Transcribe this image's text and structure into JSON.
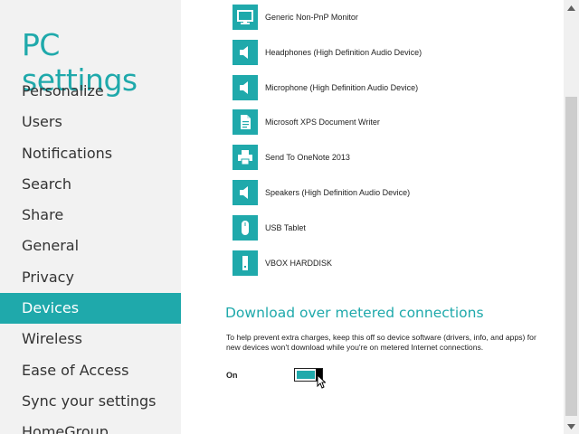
{
  "sidebar": {
    "title": "PC settings",
    "items": [
      {
        "label": "Personalize",
        "name": "personalize"
      },
      {
        "label": "Users",
        "name": "users"
      },
      {
        "label": "Notifications",
        "name": "notifications"
      },
      {
        "label": "Search",
        "name": "search"
      },
      {
        "label": "Share",
        "name": "share"
      },
      {
        "label": "General",
        "name": "general"
      },
      {
        "label": "Privacy",
        "name": "privacy"
      },
      {
        "label": "Devices",
        "name": "devices",
        "active": true
      },
      {
        "label": "Wireless",
        "name": "wireless"
      },
      {
        "label": "Ease of Access",
        "name": "ease-of-access"
      },
      {
        "label": "Sync your settings",
        "name": "sync-your-settings"
      },
      {
        "label": "HomeGroup",
        "name": "homegroup"
      }
    ]
  },
  "devices": [
    {
      "label": "Generic Non-PnP Monitor",
      "icon": "monitor-icon"
    },
    {
      "label": "Headphones (High Definition Audio Device)",
      "icon": "speaker-icon"
    },
    {
      "label": "Microphone (High Definition Audio Device)",
      "icon": "speaker-icon"
    },
    {
      "label": "Microsoft XPS Document Writer",
      "icon": "document-icon"
    },
    {
      "label": "Send To OneNote 2013",
      "icon": "printer-icon"
    },
    {
      "label": "Speakers (High Definition Audio Device)",
      "icon": "speaker-icon"
    },
    {
      "label": "USB Tablet",
      "icon": "mouse-icon"
    },
    {
      "label": "VBOX HARDDISK",
      "icon": "harddisk-icon"
    }
  ],
  "metered": {
    "title": "Download over metered connections",
    "description": "To help prevent extra charges, keep this off so device software (drivers, info, and apps) for new devices won't download while you're on metered Internet connections.",
    "state": "On"
  },
  "colors": {
    "accent": "#1fa9ab",
    "sidebar_bg": "#f2f2f2"
  }
}
